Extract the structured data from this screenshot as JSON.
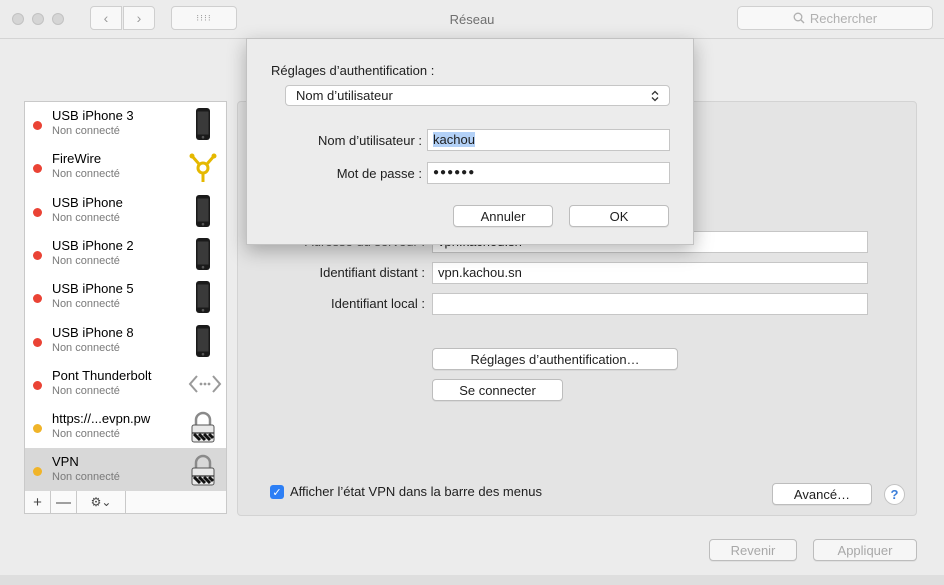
{
  "window": {
    "title": "Réseau"
  },
  "toolbar": {
    "back": "‹",
    "forward": "›",
    "grid": "⁝⁝⁝⁝",
    "search_placeholder": "Rechercher"
  },
  "services": [
    {
      "name": "USB iPhone 3",
      "status": "Non connecté",
      "dot": "red",
      "icon": "iphone-icon"
    },
    {
      "name": "FireWire",
      "status": "Non connecté",
      "dot": "red",
      "icon": "firewire-icon"
    },
    {
      "name": "USB iPhone",
      "status": "Non connecté",
      "dot": "red",
      "icon": "iphone-icon"
    },
    {
      "name": "USB iPhone 2",
      "status": "Non connecté",
      "dot": "red",
      "icon": "iphone-icon"
    },
    {
      "name": "USB iPhone 5",
      "status": "Non connecté",
      "dot": "red",
      "icon": "iphone-icon"
    },
    {
      "name": "USB iPhone 8",
      "status": "Non connecté",
      "dot": "red",
      "icon": "iphone-icon"
    },
    {
      "name": "Pont Thunderbolt",
      "status": "Non connecté",
      "dot": "red",
      "icon": "thunderbolt-bridge-icon"
    },
    {
      "name": "https://...evpn.pw",
      "status": "Non connecté",
      "dot": "yellow",
      "icon": "vpn-lock-icon"
    },
    {
      "name": "VPN",
      "status": "Non connecté",
      "dot": "yellow",
      "icon": "vpn-lock-icon"
    }
  ],
  "sidebar_toolbar": {
    "add": "+",
    "remove": "—",
    "action": "⚙︎⌄"
  },
  "vpn": {
    "server_label": "Adresse du serveur :",
    "server_value": "vpn.kachou.sn",
    "remote_id_label": "Identifiant distant :",
    "remote_id_value": "vpn.kachou.sn",
    "local_id_label": "Identifiant local :",
    "local_id_value": "",
    "auth_settings_button": "Réglages d’authentification…",
    "connect_button": "Se connecter",
    "show_status_label": "Afficher l’état VPN dans la barre des menus",
    "show_status_checked": true,
    "advanced_button": "Avancé…",
    "help": "?"
  },
  "footer": {
    "revert_button": "Revenir",
    "apply_button": "Appliquer"
  },
  "sheet": {
    "title": "Réglages d’authentification :",
    "auth_method": "Nom d’utilisateur",
    "username_label": "Nom d’utilisateur :",
    "username_value": "kachou",
    "password_label": "Mot de passe :",
    "password_value": "●●●●●●",
    "cancel_button": "Annuler",
    "ok_button": "OK"
  },
  "colors": {
    "accent": "#2d7ff5",
    "status_red": "#ea4335",
    "status_yellow": "#f0b429"
  }
}
